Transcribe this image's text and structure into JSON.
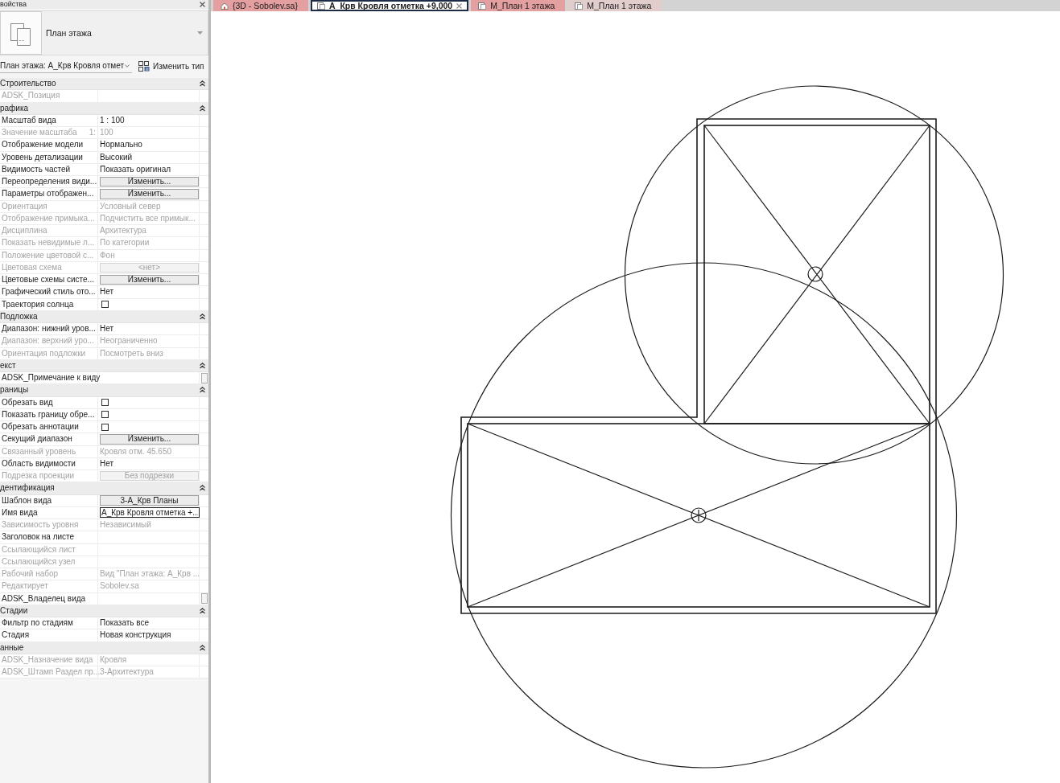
{
  "properties": {
    "title": "войства",
    "type_name": "План этажа",
    "instance": "План этажа: А_Крв Кровля отмет",
    "edit_type": "Изменить тип",
    "groups": [
      {
        "title": "Строительство",
        "expanded": true,
        "rows": [
          {
            "kind": "text",
            "label": "ADSK_Позиция",
            "disabled": true
          }
        ]
      },
      {
        "title": "рафика",
        "expanded": true,
        "rows": [
          {
            "kind": "text",
            "label": "Масштаб вида",
            "value": "1 : 100",
            "disabled": false
          },
          {
            "kind": "text",
            "label": "Значение масштаба",
            "suffix": "1:",
            "value": "100",
            "disabled": true
          },
          {
            "kind": "text",
            "label": "Отображение модели",
            "value": "Нормально",
            "disabled": false
          },
          {
            "kind": "text",
            "label": "Уровень детализации",
            "value": "Высокий",
            "disabled": false
          },
          {
            "kind": "text",
            "label": "Видимость частей",
            "value": "Показать оригинал",
            "disabled": false
          },
          {
            "kind": "button",
            "label": "Переопределения види...",
            "value": "Изменить...",
            "disabled": false
          },
          {
            "kind": "button",
            "label": "Параметры отображен...",
            "value": "Изменить...",
            "disabled": false
          },
          {
            "kind": "text",
            "label": "Ориентация",
            "value": "Условный север",
            "disabled": true
          },
          {
            "kind": "text",
            "label": "Отображение примыка...",
            "value": "Подчистить все примык...",
            "disabled": true
          },
          {
            "kind": "text",
            "label": "Дисциплина",
            "value": "Архитектура",
            "disabled": true
          },
          {
            "kind": "text",
            "label": "Показать невидимые л...",
            "value": "По категории",
            "disabled": true
          },
          {
            "kind": "text",
            "label": "Положение цветовой с...",
            "value": "Фон",
            "disabled": true
          },
          {
            "kind": "button",
            "label": "Цветовая схема",
            "value": "<нет>",
            "disabled": true
          },
          {
            "kind": "button",
            "label": "Цветовые схемы систе...",
            "value": "Изменить...",
            "disabled": false
          },
          {
            "kind": "text",
            "label": "Графический стиль ото...",
            "value": "Нет",
            "disabled": false
          },
          {
            "kind": "checkbox",
            "label": "Траектория солнца",
            "checked": false,
            "disabled": false
          }
        ]
      },
      {
        "title": "Подложка",
        "expanded": true,
        "rows": [
          {
            "kind": "text",
            "label": "Диапазон: нижний уров...",
            "value": "Нет",
            "disabled": false
          },
          {
            "kind": "text",
            "label": "Диапазон: верхний уро...",
            "value": "Неограниченно",
            "disabled": true
          },
          {
            "kind": "text",
            "label": "Ориентация подложки",
            "value": "Посмотреть вниз",
            "disabled": true
          }
        ]
      },
      {
        "title": "екст",
        "expanded": true,
        "rows": [
          {
            "kind": "note",
            "label": "ADSK_Примечание к виду",
            "disabled": false
          }
        ]
      },
      {
        "title": "раницы",
        "expanded": true,
        "rows": [
          {
            "kind": "checkbox",
            "label": "Обрезать вид",
            "checked": false,
            "disabled": false
          },
          {
            "kind": "checkbox",
            "label": "Показать границу обре...",
            "checked": false,
            "disabled": false
          },
          {
            "kind": "checkbox",
            "label": "Обрезать аннотации",
            "checked": false,
            "disabled": false
          },
          {
            "kind": "button",
            "label": "Секущий диапазон",
            "value": "Изменить...",
            "disabled": false
          },
          {
            "kind": "text",
            "label": "Связанный уровень",
            "value": "Кровля отм. 45.650",
            "disabled": true
          },
          {
            "kind": "text",
            "label": "Область видимости",
            "value": "Нет",
            "disabled": false
          },
          {
            "kind": "button",
            "label": "Подрезка проекции",
            "value": "Без подрезки",
            "disabled": true
          }
        ]
      },
      {
        "title": "дентификация",
        "expanded": true,
        "rows": [
          {
            "kind": "button",
            "label": "Шаблон вида",
            "value": "3-А_Крв Планы",
            "disabled": false
          },
          {
            "kind": "input",
            "label": "Имя вида",
            "value": "А_Крв Кровля отметка +...",
            "disabled": false
          },
          {
            "kind": "text",
            "label": "Зависимость уровня",
            "value": "Независимый",
            "disabled": true
          },
          {
            "kind": "text",
            "label": "Заголовок на листе",
            "disabled": false
          },
          {
            "kind": "text",
            "label": "Ссылающийся лист",
            "disabled": true
          },
          {
            "kind": "text",
            "label": "Ссылающийся узел",
            "disabled": true
          },
          {
            "kind": "text",
            "label": "Рабочий набор",
            "value": "Вид \"План этажа: А_Крв ...",
            "disabled": true
          },
          {
            "kind": "text",
            "label": "Редактирует",
            "value": "Sobolev.sa",
            "disabled": true
          },
          {
            "kind": "note",
            "label": "ADSK_Владелец вида",
            "disabled": false
          }
        ]
      },
      {
        "title": "Стадии",
        "expanded": true,
        "rows": [
          {
            "kind": "text",
            "label": "Фильтр по стадиям",
            "value": "Показать все",
            "disabled": false
          },
          {
            "kind": "text",
            "label": "Стадия",
            "value": "Новая конструкция",
            "disabled": false
          }
        ]
      },
      {
        "title": "анные",
        "expanded": true,
        "rows": [
          {
            "kind": "text",
            "label": "ADSK_Назначение вида",
            "value": "Кровля",
            "disabled": true
          },
          {
            "kind": "text",
            "label": "ADSK_Штамп Раздел пр...",
            "value": "3-Архитектура",
            "disabled": true
          }
        ]
      }
    ]
  },
  "view_tabs": [
    {
      "kind": "model",
      "label": "{3D - Sobolev.sa}",
      "selected": false,
      "color": "#e4a0a0"
    },
    {
      "kind": "plan",
      "label": "А_Крв Кровля отметка +9,000",
      "selected": true
    },
    {
      "kind": "plan",
      "label": "М_План 1 этажа",
      "selected": false,
      "color": "#e4a0a0"
    },
    {
      "kind": "plan",
      "label": "М_План 1 этажа",
      "selected": false,
      "color": "#e2cdcd"
    }
  ]
}
